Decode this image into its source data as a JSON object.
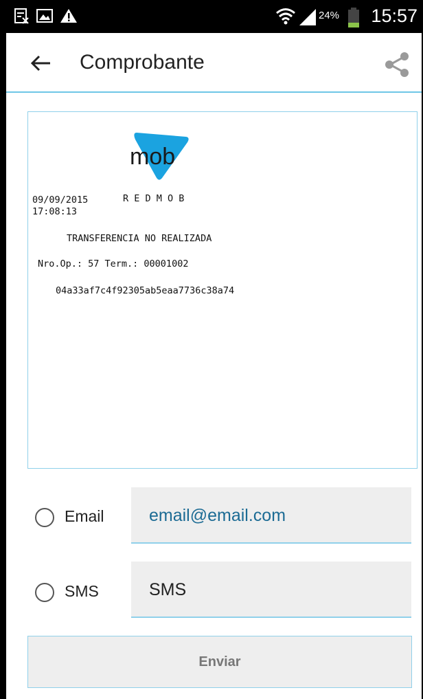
{
  "status_bar": {
    "battery_percent": "24%",
    "time": "15:57",
    "icons": [
      "no-sim-icon",
      "image-icon",
      "warning-icon",
      "wifi-icon",
      "signal-icon",
      "battery-icon"
    ]
  },
  "app_bar": {
    "title": "Comprobante",
    "back_icon": "arrow-left-icon",
    "share_icon": "share-icon"
  },
  "receipt": {
    "logo_text": "mob",
    "date": "09/09/2015",
    "brand": "R E D M O B",
    "time": "17:08:13",
    "status": "TRANSFERENCIA NO REALIZADA",
    "operation": "Nro.Op.: 57 Term.: 00001002",
    "hash": "04a33af7c4f92305ab5eaa7736c38a74"
  },
  "form": {
    "email_label": "Email",
    "email_value": "email@email.com",
    "sms_label": "SMS",
    "sms_value": "SMS",
    "send_label": "Enviar"
  },
  "colors": {
    "accent": "#6ec6e6",
    "logo": "#1ba3e0",
    "email_text": "#1c6b94"
  }
}
